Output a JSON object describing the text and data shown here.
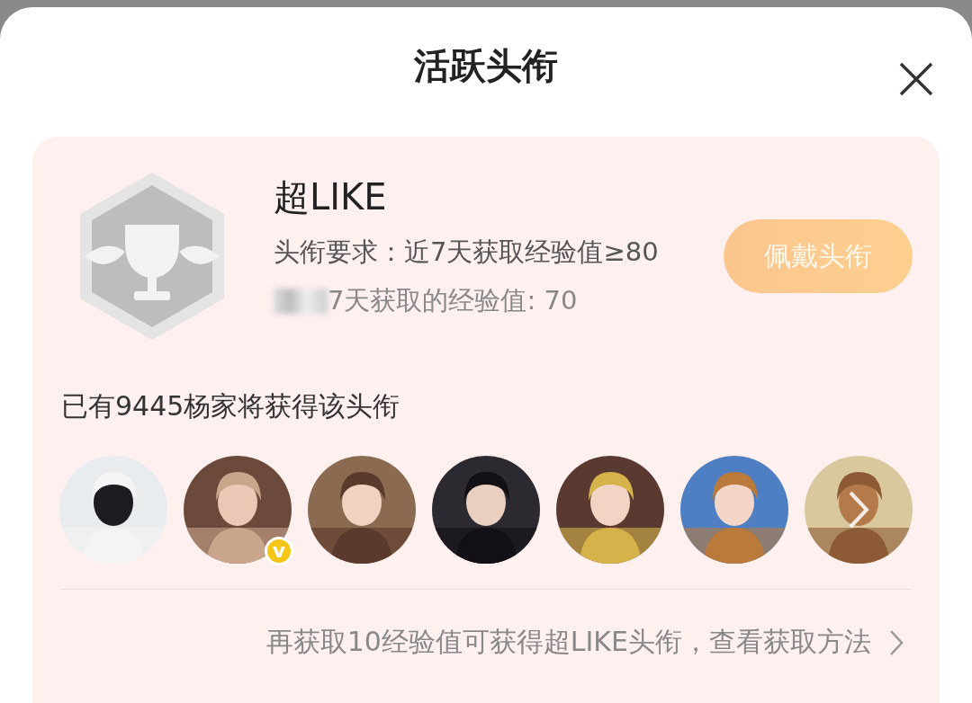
{
  "header": {
    "title": "活跃头衔"
  },
  "title_card": {
    "name": "超LIKE",
    "requirement": "头衔要求：近7天获取经验值≥80",
    "progress_redacted": true,
    "progress": "7天获取的经验值: 70",
    "wear_button": {
      "label": "佩戴头衔",
      "disabled": true
    }
  },
  "holders": {
    "summary": "已有9445杨家将获得该头衔",
    "avatars": [
      {
        "kind": "picture",
        "verified": false,
        "more": false
      },
      {
        "kind": "picture",
        "verified": true,
        "badge": "v",
        "more": false
      },
      {
        "kind": "picture",
        "verified": false,
        "more": false
      },
      {
        "kind": "picture",
        "verified": false,
        "more": false
      },
      {
        "kind": "picture",
        "verified": false,
        "more": false
      },
      {
        "kind": "picture",
        "verified": false,
        "more": false
      },
      {
        "kind": "picture",
        "verified": false,
        "more": true
      }
    ]
  },
  "footer": {
    "hint": "再获取10经验值可获得超LIKE头衔，查看获取方法"
  }
}
